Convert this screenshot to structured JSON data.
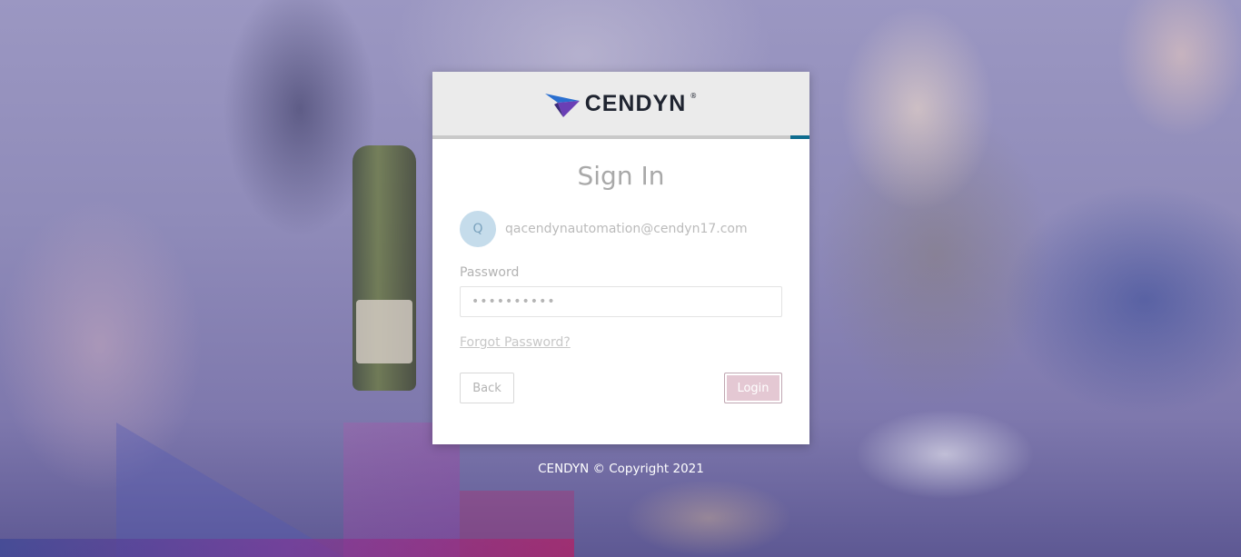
{
  "brand": {
    "name": "CENDYN",
    "registered_mark": "®",
    "colors": {
      "primary": "#0e6c8f",
      "logo_dark": "#1f2430",
      "logo_purple": "#6a3fb5",
      "logo_blue": "#2a6fd0"
    }
  },
  "signin": {
    "title": "Sign In",
    "user_initial": "Q",
    "user_email": "qacendynautomation@cendyn17.com",
    "password_label": "Password",
    "password_value": "••••••••••",
    "forgot_link": "Forgot Password?",
    "back_label": "Back",
    "login_label": "Login",
    "login_color": "#e4c8d3"
  },
  "footer": {
    "copyright": "CENDYN © Copyright 2021"
  }
}
